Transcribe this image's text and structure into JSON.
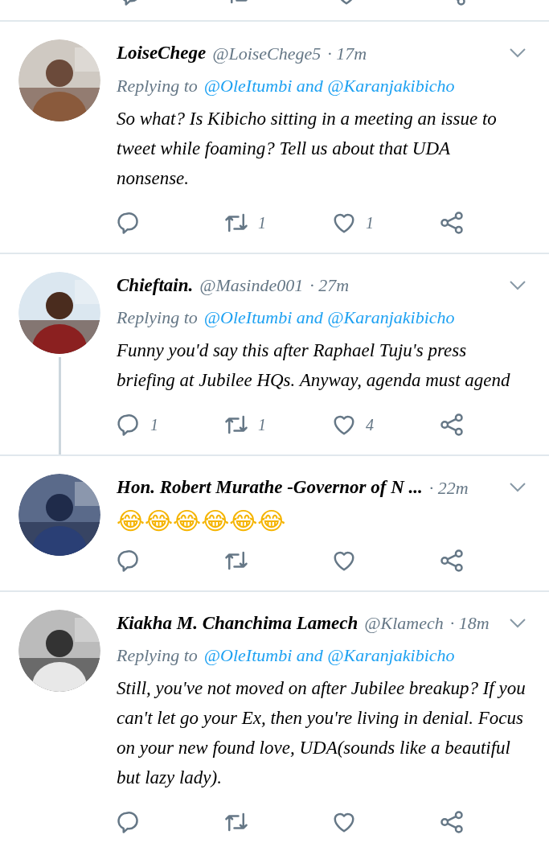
{
  "tweets": [
    {
      "name": "LoiseChege",
      "handle": "@LoiseChege5",
      "time": "· 17m",
      "replying_label": "Replying to",
      "replying_links": "@OleItumbi and @Karanjakibicho",
      "text": "So what? Is Kibicho sitting in a meeting an issue to tweet while foaming? Tell us about that UDA nonsense.",
      "thread_continues": false,
      "actions": [
        {
          "kind": "reply"
        },
        {
          "kind": "retweet",
          "count": "1"
        },
        {
          "kind": "like",
          "count": "1"
        },
        {
          "kind": "share"
        }
      ]
    },
    {
      "name": "Chieftain.",
      "handle": "@Masinde001",
      "time": "· 27m",
      "replying_label": "Replying to",
      "replying_links": "@OleItumbi and @Karanjakibicho",
      "text": "Funny you'd say this after Raphael Tuju's press briefing at Jubilee HQs. Anyway, agenda must agend",
      "thread_continues": true,
      "actions": [
        {
          "kind": "reply",
          "count": "1"
        },
        {
          "kind": "retweet",
          "count": "1"
        },
        {
          "kind": "like",
          "count": "4"
        },
        {
          "kind": "share"
        }
      ]
    },
    {
      "name": "Hon. Robert Murathe -Governor of N ...",
      "time": "· 22m",
      "text": "😂😂😂😂😂😂",
      "thread_continues": false,
      "actions": [
        {
          "kind": "reply"
        },
        {
          "kind": "retweet"
        },
        {
          "kind": "like"
        },
        {
          "kind": "share"
        }
      ]
    },
    {
      "name": "Kiakha M. Chanchima Lamech",
      "handle": "@Klamech",
      "time": "· 18m",
      "replying_label": "Replying to",
      "replying_links": "@OleItumbi and @Karanjakibicho",
      "text": "Still, you've not moved on after Jubilee breakup? If you can't let go your Ex, then you're living in denial. Focus on your new found love, UDA(sounds like a beautiful but lazy lady).",
      "thread_continues": false,
      "actions": [
        {
          "kind": "reply"
        },
        {
          "kind": "retweet"
        },
        {
          "kind": "like"
        },
        {
          "kind": "share"
        }
      ]
    }
  ]
}
